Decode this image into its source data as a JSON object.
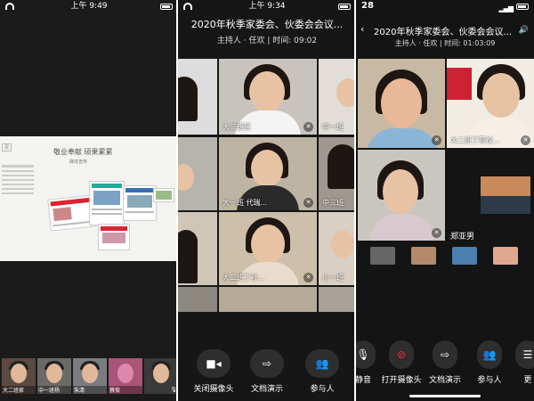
{
  "panel1": {
    "status_time": "上午 9:49",
    "slide": {
      "title": "敬业奉献  硕果累累",
      "subtitle": "媒体宣传",
      "tag": "展"
    },
    "participants": [
      {
        "name": "大二班家"
      },
      {
        "name": "中一班杨"
      },
      {
        "name": "朱清"
      },
      {
        "name": "蔡俊"
      },
      {
        "name": ""
      }
    ]
  },
  "panel2": {
    "status_time": "上午 9:34",
    "meeting_title": "2020年秋季家委会、伙委会会议...",
    "host_line": "主持人 · 任欢  |  时间: 09:02",
    "tiles": [
      {
        "label": "大三班区"
      },
      {
        "label": "中一班"
      },
      {
        "label": "大一班 代瑞..."
      },
      {
        "label": "中三班"
      },
      {
        "label": "大二班丁孙..."
      },
      {
        "label": "小一班"
      }
    ],
    "toolbar": [
      {
        "label": "关闭摄像头",
        "icon": "camera-icon"
      },
      {
        "label": "文档演示",
        "icon": "share-screen-icon"
      },
      {
        "label": "参与人",
        "icon": "participants-icon"
      }
    ]
  },
  "panel3": {
    "status_time": "28",
    "meeting_title": "2020年秋季家委会、伙委会会议...",
    "host_line": "主持人 · 任欢  |  时间: 01:03:09",
    "tiles": [
      {
        "label": ""
      },
      {
        "label": "大二班丁慕议..."
      },
      {
        "label": ""
      }
    ],
    "speaker_name": "郑亚男",
    "toolbar": [
      {
        "label": "静音",
        "icon": "mute-icon"
      },
      {
        "label": "打开摄像头",
        "icon": "camera-off-icon"
      },
      {
        "label": "文档演示",
        "icon": "share-screen-icon"
      },
      {
        "label": "参与人",
        "icon": "participants-icon"
      },
      {
        "label": "更",
        "icon": "more-icon"
      }
    ]
  }
}
